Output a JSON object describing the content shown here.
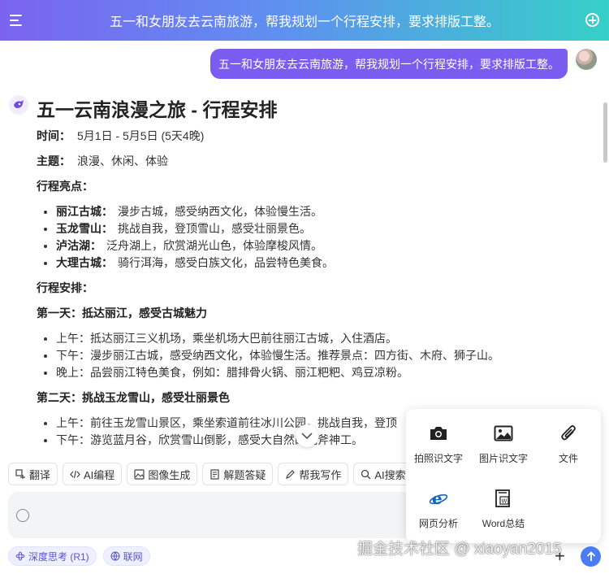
{
  "header": {
    "title": "五一和女朋友去云南旅游，帮我规划一个行程安排，要求排版工整。"
  },
  "user_message": "五一和女朋友去云南旅游，帮我规划一个行程安排，要求排版工整。",
  "answer": {
    "title": "五一云南浪漫之旅 - 行程安排",
    "time_label": "时间：",
    "time_value": "5月1日 - 5月5日 (5天4晚)",
    "theme_label": "主题：",
    "theme_value": "浪漫、休闲、体验",
    "highlights_heading": "行程亮点：",
    "highlights": [
      {
        "name": "丽江古城：",
        "desc": "漫步古城，感受纳西文化，体验慢生活。"
      },
      {
        "name": "玉龙雪山：",
        "desc": "挑战自我，登顶雪山，感受壮丽景色。"
      },
      {
        "name": "泸沽湖：",
        "desc": "泛舟湖上，欣赏湖光山色，体验摩梭风情。"
      },
      {
        "name": "大理古城：",
        "desc": "骑行洱海，感受白族文化，品尝特色美食。"
      }
    ],
    "schedule_heading": "行程安排：",
    "day1_heading": "第一天：抵达丽江，感受古城魅力",
    "day1": [
      "上午：抵达丽江三义机场，乘坐机场大巴前往丽江古城，入住酒店。",
      "下午：漫步丽江古城，感受纳西文化，体验慢生活。推荐景点：四方街、木府、狮子山。",
      "晚上：品尝丽江特色美食，例如：腊排骨火锅、丽江粑粑、鸡豆凉粉。"
    ],
    "day2_heading": "第二天：挑战玉龙雪山，感受壮丽景色",
    "day2": [
      "上午：前往玉龙雪山景区，乘坐索道前往冰川公园，挑战自我，登顶",
      "下午：游览蓝月谷，欣赏雪山倒影，感受大自然的鬼斧神工。"
    ]
  },
  "tools": [
    {
      "name": "translate",
      "label": "翻译"
    },
    {
      "name": "ai-code",
      "label": "AI编程"
    },
    {
      "name": "image-gen",
      "label": "图像生成"
    },
    {
      "name": "solve",
      "label": "解题答疑"
    },
    {
      "name": "write",
      "label": "帮我写作"
    },
    {
      "name": "ai-search",
      "label": "AI搜索"
    }
  ],
  "input": {
    "placeholder": ""
  },
  "toggles": {
    "deep_think": "深度思考 (R1)",
    "web": "联网"
  },
  "popup": [
    {
      "label": "拍照识文字",
      "icon": "camera-icon"
    },
    {
      "label": "图片识文字",
      "icon": "image-icon"
    },
    {
      "label": "文件",
      "icon": "paperclip-icon"
    },
    {
      "label": "网页分析",
      "icon": "browser-icon"
    },
    {
      "label": "Word总结",
      "icon": "word-icon"
    }
  ],
  "watermark": "掘金技术社区 @ xiaoyan2015",
  "colors": {
    "accent": "#7a5cf0",
    "send": "#4a7cf3"
  }
}
